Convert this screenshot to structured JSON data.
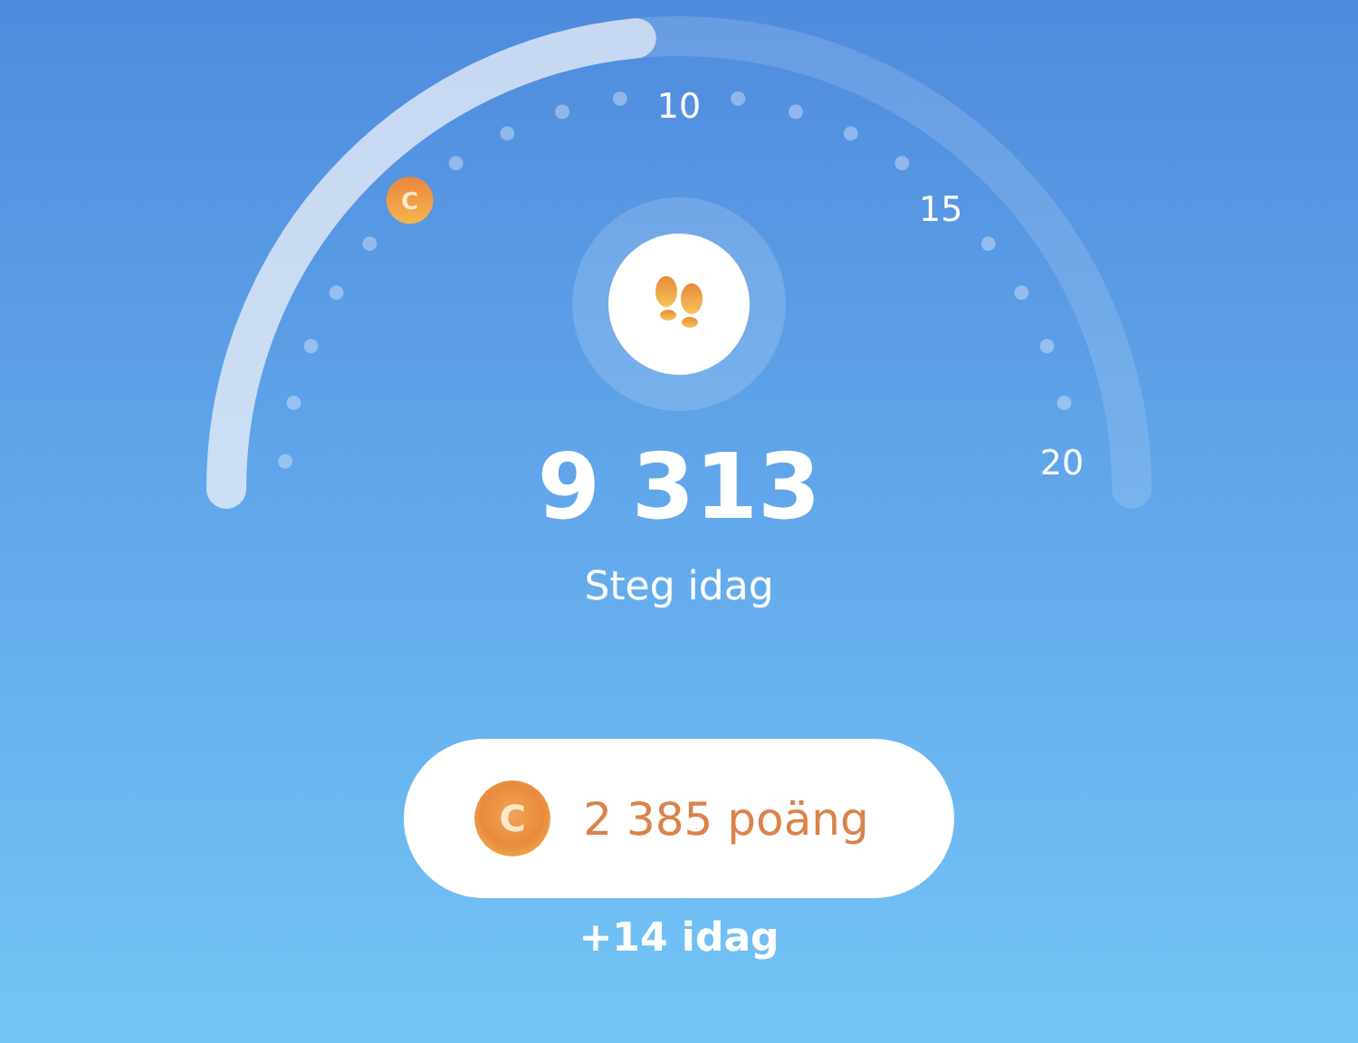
{
  "gauge": {
    "markers": [
      {
        "kind": "dot"
      },
      {
        "kind": "dot"
      },
      {
        "kind": "dot"
      },
      {
        "kind": "dot"
      },
      {
        "kind": "dot"
      },
      {
        "kind": "coin",
        "label": "C"
      },
      {
        "kind": "dot"
      },
      {
        "kind": "dot"
      },
      {
        "kind": "dot"
      },
      {
        "kind": "dot"
      },
      {
        "kind": "label",
        "label": "10"
      },
      {
        "kind": "dot"
      },
      {
        "kind": "dot"
      },
      {
        "kind": "dot"
      },
      {
        "kind": "dot"
      },
      {
        "kind": "label",
        "label": "15"
      },
      {
        "kind": "dot"
      },
      {
        "kind": "dot"
      },
      {
        "kind": "dot"
      },
      {
        "kind": "dot"
      },
      {
        "kind": "label",
        "label": "20"
      }
    ]
  },
  "steps": {
    "value": "9 313",
    "label": "Steg idag"
  },
  "points": {
    "coin_symbol": "C",
    "value": "2 385 poäng",
    "today": "+14 idag"
  }
}
